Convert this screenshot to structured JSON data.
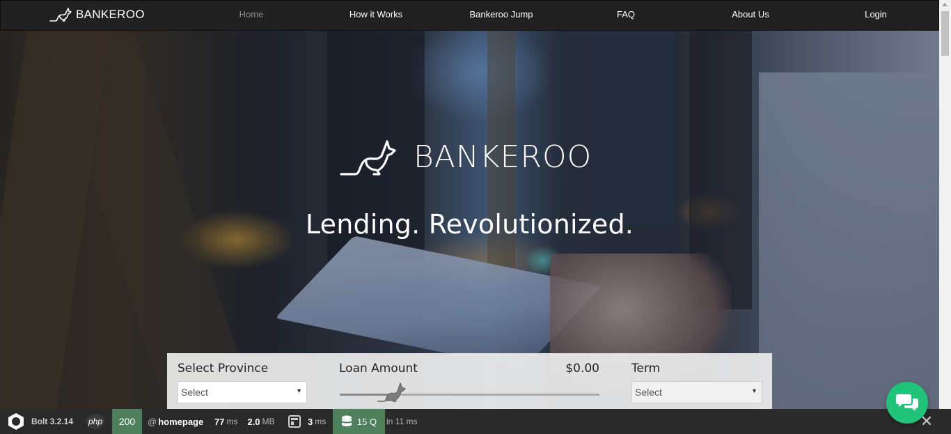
{
  "brand": {
    "name": "BANKEROO"
  },
  "nav": {
    "items": [
      {
        "label": "Home",
        "active": true
      },
      {
        "label": "How it Works"
      },
      {
        "label": "Bankeroo Jump"
      },
      {
        "label": "FAQ"
      },
      {
        "label": "About Us"
      },
      {
        "label": "Login"
      }
    ]
  },
  "hero": {
    "logo_text": "BANKEROO",
    "tagline": "Lending. Revolutionized."
  },
  "form": {
    "province_label": "Select Province",
    "province_value": "Select",
    "amount_label": "Loan Amount",
    "amount_value": "$0.00",
    "amount_fraction": 0.2,
    "term_label": "Term",
    "term_value": "Select"
  },
  "debugbar": {
    "version": "Bolt 3.2.14",
    "php": "php",
    "status": "200",
    "route_prefix": "@",
    "route": "homepage",
    "time_value": "77",
    "time_unit": "ms",
    "memory_value": "2.0",
    "memory_unit": "MB",
    "render_value": "3",
    "render_unit": "ms",
    "queries": "15 Q",
    "queries_time": "in 11 ms"
  },
  "colors": {
    "accent_green": "#21c37a",
    "debug_green": "#4f805d",
    "navbar": "#212121"
  },
  "icons": [
    "kangaroo-logo-icon",
    "chevron-down-icon",
    "chat-icon",
    "close-icon",
    "bolt-logo-icon",
    "template-icon",
    "database-icon"
  ]
}
